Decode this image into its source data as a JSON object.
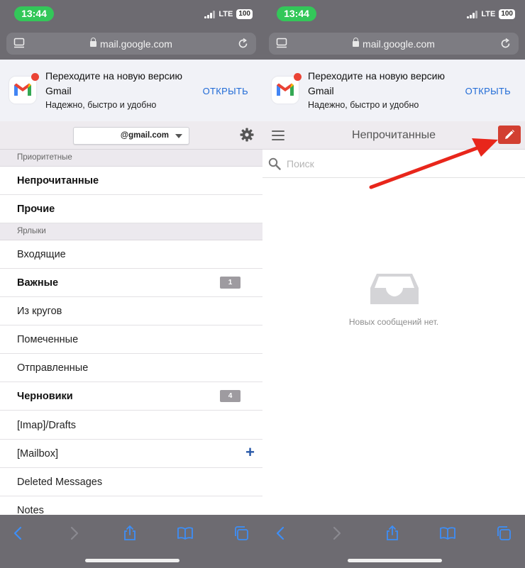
{
  "status": {
    "time": "13:44",
    "network": "LTE",
    "battery": "100"
  },
  "browser": {
    "url": "mail.google.com"
  },
  "banner": {
    "title": "Переходите на новую версию Gmail",
    "subtitle": "Надежно, быстро и удобно",
    "open_label": "ОТКРЫТЬ"
  },
  "left": {
    "account": "@gmail.com",
    "priority_header": "Приоритетные",
    "priority_items": [
      {
        "label": "Непрочитанные"
      },
      {
        "label": "Прочие"
      }
    ],
    "labels_header": "Ярлыки",
    "label_items": [
      {
        "label": "Входящие",
        "bold": false
      },
      {
        "label": "Важные",
        "bold": true,
        "count": "1"
      },
      {
        "label": "Из кругов",
        "bold": false
      },
      {
        "label": "Помеченные",
        "bold": false
      },
      {
        "label": "Отправленные",
        "bold": false
      },
      {
        "label": "Черновики",
        "bold": true,
        "count": "4"
      },
      {
        "label": "[Imap]/Drafts",
        "bold": false
      },
      {
        "label": "[Mailbox]",
        "bold": false,
        "plus": "+"
      },
      {
        "label": "Deleted Messages",
        "bold": false
      },
      {
        "label": "Notes",
        "bold": false
      }
    ]
  },
  "right": {
    "title": "Непрочитанные",
    "search_placeholder": "Поиск",
    "empty_text": "Новых сообщений нет."
  },
  "colors": {
    "status_green": "#33c759",
    "compose_red": "#d23f31",
    "link_blue": "#1f6ad6",
    "arrow_red": "#e8261b",
    "toolbar_bg": "#6d6b71"
  },
  "icons": {
    "toolbar": [
      "chevron-left-icon",
      "chevron-right-icon",
      "share-icon",
      "book-icon",
      "tabs-icon"
    ]
  }
}
